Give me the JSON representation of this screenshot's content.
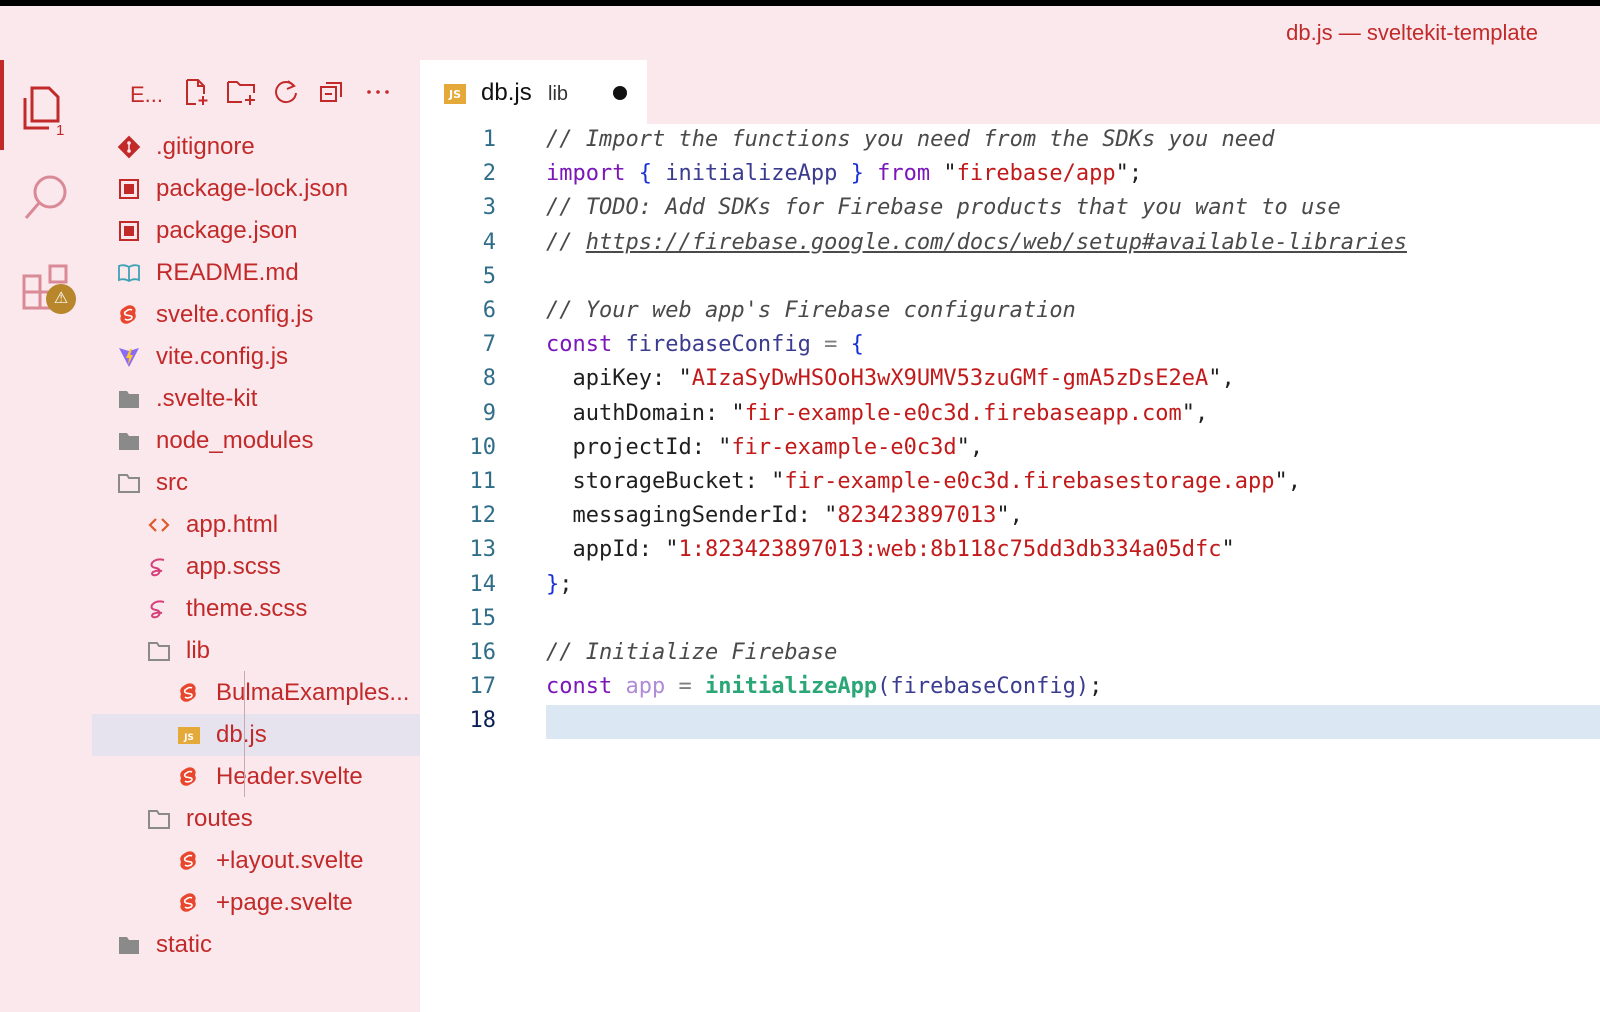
{
  "window": {
    "title": "db.js — sveltekit-template"
  },
  "activity_bar": {
    "items": [
      {
        "name": "explorer",
        "icon": "files-icon",
        "badge": "1"
      },
      {
        "name": "search",
        "icon": "search-icon"
      },
      {
        "name": "extensions",
        "icon": "extensions-icon",
        "badge_icon": "warning-icon"
      }
    ]
  },
  "sidebar": {
    "title": "E...",
    "tools": [
      "new-file-icon",
      "new-folder-icon",
      "refresh-icon",
      "collapse-all-icon",
      "more-icon"
    ],
    "tree": [
      {
        "label": ".gitignore",
        "icon": "git-icon",
        "depth": 0
      },
      {
        "label": "package-lock.json",
        "icon": "json-icon",
        "depth": 0
      },
      {
        "label": "package.json",
        "icon": "json-icon",
        "depth": 0
      },
      {
        "label": "README.md",
        "icon": "book-icon",
        "depth": 0
      },
      {
        "label": "svelte.config.js",
        "icon": "svelte-icon",
        "depth": 0
      },
      {
        "label": "vite.config.js",
        "icon": "vite-icon",
        "depth": 0
      },
      {
        "label": ".svelte-kit",
        "icon": "folder-icon",
        "depth": 0
      },
      {
        "label": "node_modules",
        "icon": "folder-icon",
        "depth": 0
      },
      {
        "label": "src",
        "icon": "folder-open-icon",
        "depth": 0
      },
      {
        "label": "app.html",
        "icon": "html-icon",
        "depth": 1
      },
      {
        "label": "app.scss",
        "icon": "sass-icon",
        "depth": 1
      },
      {
        "label": "theme.scss",
        "icon": "sass-icon",
        "depth": 1
      },
      {
        "label": "lib",
        "icon": "folder-open-icon",
        "depth": 1
      },
      {
        "label": "BulmaExamples...",
        "icon": "svelte-icon",
        "depth": 2
      },
      {
        "label": "db.js",
        "icon": "js-icon",
        "depth": 2,
        "selected": true
      },
      {
        "label": "Header.svelte",
        "icon": "svelte-icon",
        "depth": 2
      },
      {
        "label": "routes",
        "icon": "folder-open-icon",
        "depth": 1
      },
      {
        "label": "+layout.svelte",
        "icon": "svelte-icon",
        "depth": 2
      },
      {
        "label": "+page.svelte",
        "icon": "svelte-icon",
        "depth": 2
      },
      {
        "label": "static",
        "icon": "folder-icon",
        "depth": 0
      }
    ]
  },
  "editor": {
    "tab": {
      "icon_text": "JS",
      "name": "db.js",
      "description": "lib",
      "dirty": true
    },
    "current_line": 18,
    "lines": [
      {
        "n": "1",
        "tokens": [
          [
            "c-comment",
            "// Import the functions you need from the SDKs you need"
          ]
        ]
      },
      {
        "n": "2",
        "tokens": [
          [
            "c-kw",
            "import"
          ],
          [
            "c-punc",
            " "
          ],
          [
            "c-brace",
            "{"
          ],
          [
            "c-punc",
            " "
          ],
          [
            "c-var",
            "initializeApp"
          ],
          [
            "c-punc",
            " "
          ],
          [
            "c-brace",
            "}"
          ],
          [
            "c-punc",
            " "
          ],
          [
            "c-kw",
            "from"
          ],
          [
            "c-punc",
            " \""
          ],
          [
            "c-str",
            "firebase/app"
          ],
          [
            "c-punc",
            "\";"
          ]
        ]
      },
      {
        "n": "3",
        "tokens": [
          [
            "c-comment",
            "// TODO: Add SDKs for Firebase products that you want to use"
          ]
        ]
      },
      {
        "n": "4",
        "tokens": [
          [
            "c-comment",
            "// "
          ],
          [
            "c-comment c-link",
            "https://firebase.google.com/docs/web/setup#available-libraries"
          ]
        ]
      },
      {
        "n": "5",
        "tokens": []
      },
      {
        "n": "6",
        "tokens": [
          [
            "c-comment",
            "// Your web app's Firebase configuration"
          ]
        ]
      },
      {
        "n": "7",
        "tokens": [
          [
            "c-kw",
            "const"
          ],
          [
            "c-punc",
            " "
          ],
          [
            "c-var",
            "firebaseConfig"
          ],
          [
            "c-punc",
            " "
          ],
          [
            "c-op",
            "="
          ],
          [
            "c-punc",
            " "
          ],
          [
            "c-brace",
            "{"
          ]
        ]
      },
      {
        "n": "8",
        "tokens": [
          [
            "c-prop",
            "  apiKey: \""
          ],
          [
            "c-str",
            "AIzaSyDwHSOoH3wX9UMV53zuGMf-gmA5zDsE2eA"
          ],
          [
            "c-punc",
            "\","
          ]
        ]
      },
      {
        "n": "9",
        "tokens": [
          [
            "c-prop",
            "  authDomain: \""
          ],
          [
            "c-str",
            "fir-example-e0c3d.firebaseapp.com"
          ],
          [
            "c-punc",
            "\","
          ]
        ]
      },
      {
        "n": "10",
        "tokens": [
          [
            "c-prop",
            "  projectId: \""
          ],
          [
            "c-str",
            "fir-example-e0c3d"
          ],
          [
            "c-punc",
            "\","
          ]
        ]
      },
      {
        "n": "11",
        "tokens": [
          [
            "c-prop",
            "  storageBucket: \""
          ],
          [
            "c-str",
            "fir-example-e0c3d.firebasestorage.app"
          ],
          [
            "c-punc",
            "\","
          ]
        ]
      },
      {
        "n": "12",
        "tokens": [
          [
            "c-prop",
            "  messagingSenderId: \""
          ],
          [
            "c-str",
            "823423897013"
          ],
          [
            "c-punc",
            "\","
          ]
        ]
      },
      {
        "n": "13",
        "tokens": [
          [
            "c-prop",
            "  appId: \""
          ],
          [
            "c-str",
            "1:823423897013:web:8b118c75dd3db334a05dfc"
          ],
          [
            "c-punc",
            "\""
          ]
        ]
      },
      {
        "n": "14",
        "tokens": [
          [
            "c-brace",
            "}"
          ],
          [
            "c-punc",
            ";"
          ]
        ]
      },
      {
        "n": "15",
        "tokens": []
      },
      {
        "n": "16",
        "tokens": [
          [
            "c-comment",
            "// Initialize Firebase"
          ]
        ]
      },
      {
        "n": "17",
        "tokens": [
          [
            "c-kw",
            "const"
          ],
          [
            "c-punc",
            " "
          ],
          [
            "c-unused",
            "app"
          ],
          [
            "c-punc",
            " "
          ],
          [
            "c-op",
            "="
          ],
          [
            "c-punc",
            " "
          ],
          [
            "c-fn",
            "initializeApp"
          ],
          [
            "c-var",
            "(firebaseConfig)"
          ],
          [
            "c-punc",
            ";"
          ]
        ]
      },
      {
        "n": "18",
        "tokens": []
      }
    ]
  },
  "colors": {
    "accent": "#c22a2a",
    "sidebar_bg": "#fbe8ec",
    "selection": "#e6e2ee",
    "current_line": "#dce7f4"
  }
}
